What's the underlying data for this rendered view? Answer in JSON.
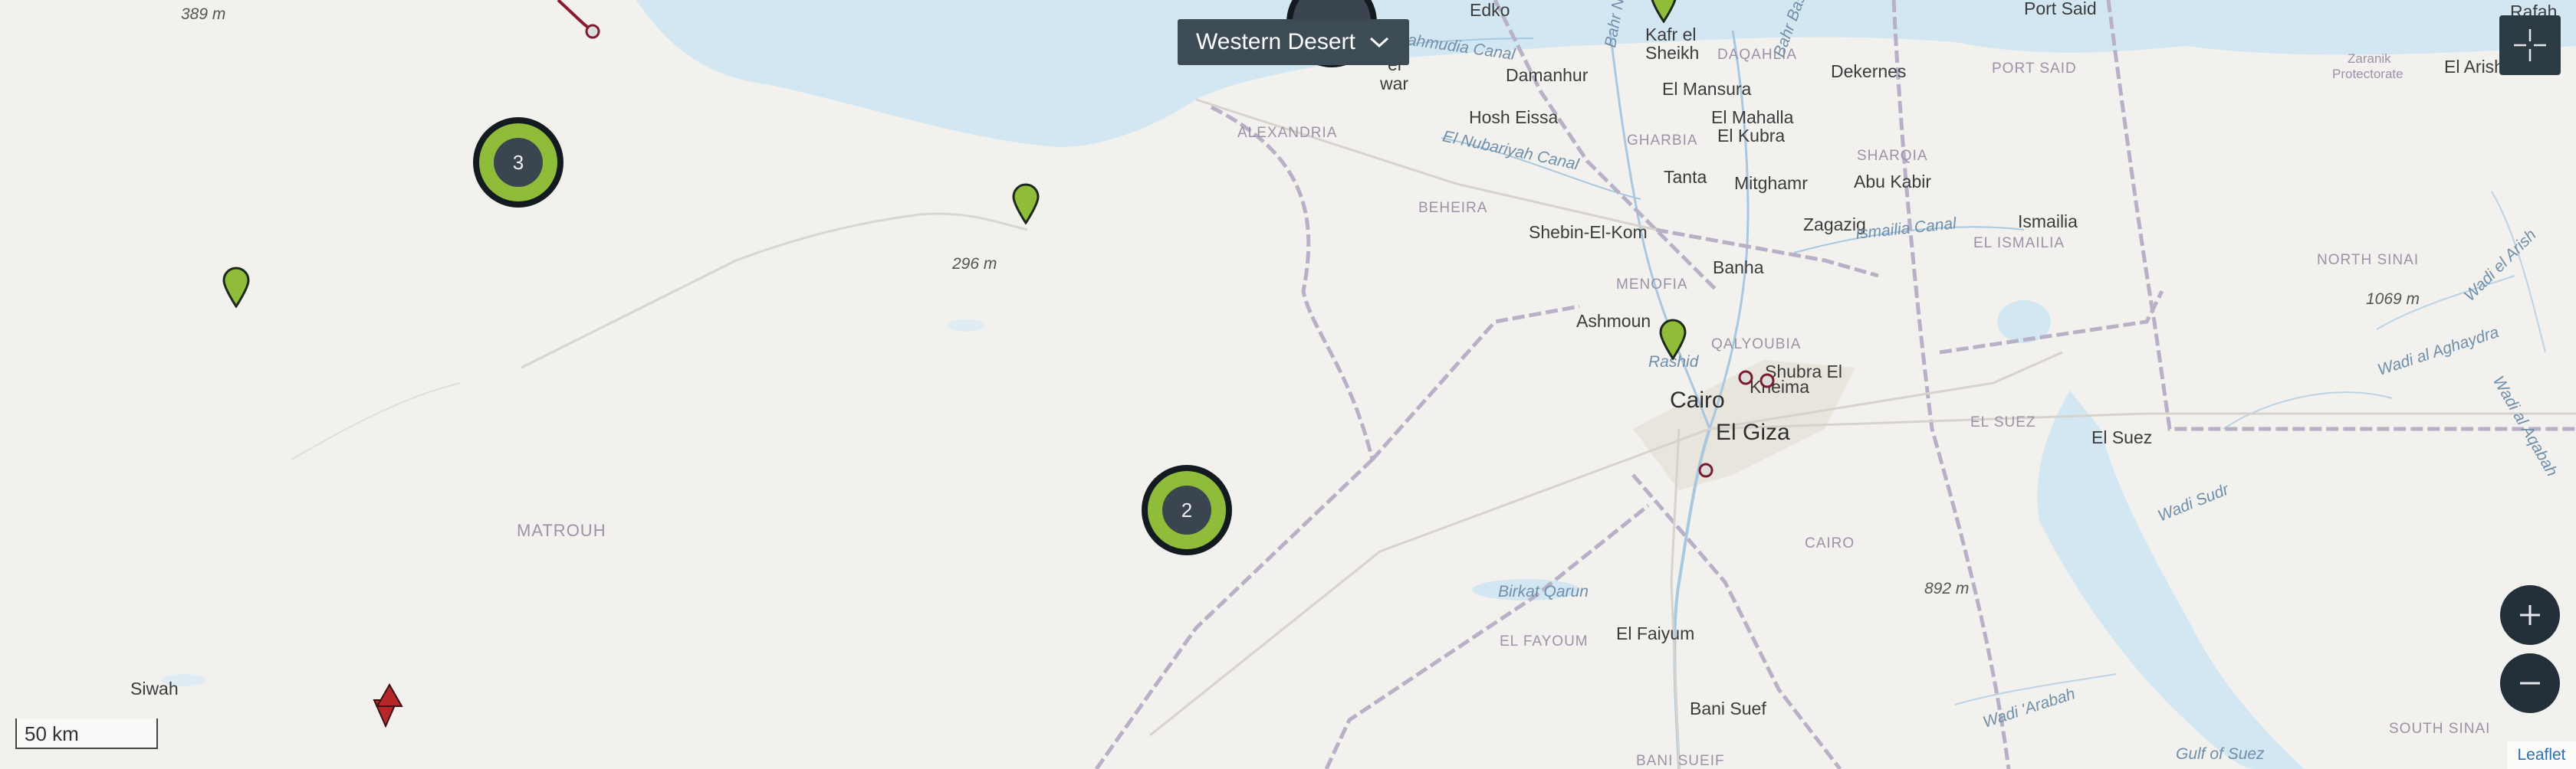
{
  "region_selector": {
    "label": "Western Desert"
  },
  "scale_bar": {
    "label": "50 km"
  },
  "attribution": {
    "label": "Leaflet"
  },
  "colors": {
    "cluster_ring": "#8fbd3a",
    "pin_green": "#8fbd3a",
    "pin_red": "#b4282a",
    "control_bg": "#23303a",
    "water": "#d3e7f3"
  },
  "clusters": [
    {
      "count": "3"
    },
    {
      "count": "2"
    }
  ],
  "labels": {
    "edko": "Edko",
    "kafr_el_sheikh_1": "Kafr el",
    "kafr_el_sheikh_2": "Sheikh",
    "port_said_city": "Port Said",
    "rafah": "Rafah",
    "damanhur": "Damanhur",
    "el_mansura": "El Mansura",
    "dekernes": "Dekernes",
    "el_arish": "El Arish",
    "hosh_eissa": "Hosh Eissa",
    "el_mahalla_1": "El Mahalla",
    "el_mahalla_2": "El Kubra",
    "tanta": "Tanta",
    "mitghamr": "Mitghamr",
    "abu_kabir": "Abu Kabir",
    "zagazig": "Zagazig",
    "ismailia": "Ismailia",
    "shebin": "Shebin-El-Kom",
    "banha": "Banha",
    "ashmoun": "Ashmoun",
    "shubra": "Shubra El",
    "kheima": "Kheima",
    "cairo": "Cairo",
    "el_giza": "El Giza",
    "el_suez": "El Suez",
    "el_faiyum": "El Faiyum",
    "bani_suef": "Bani Suef",
    "siwah": "Siwah",
    "el_wal_1": "el",
    "el_wal_2": "war",
    "region_alexandria": "ALEXANDRIA",
    "region_beheira": "BEHEIRA",
    "region_gharbia": "GHARBIA",
    "region_daqahlia": "DAQAHLIA",
    "region_port_said": "PORT SAID",
    "region_sharqia": "SHARQIA",
    "region_ismailia": "EL ISMAILIA",
    "region_menofia": "MENOFIA",
    "region_qalyoubia": "QALYOUBIA",
    "region_cairo": "CAIRO",
    "region_el_suez": "EL SUEZ",
    "region_fayoum": "EL FAYOUM",
    "region_beni_suef": "BANI SUEIF",
    "region_matrouh": "MATROUH",
    "region_north_sinai": "NORTH SINAI",
    "region_south_sinai": "SOUTH SINAI",
    "region_zaranik_1": "Zaranik",
    "region_zaranik_2": "Protectorate",
    "water_nubariyah": "El Nubariyah Canal",
    "water_mahmudia": "Mahmudia Canal",
    "water_ismailia": "Ismailia Canal",
    "water_birkat_qarun": "Birkat Qarun",
    "water_wadi_sudr": "Wadi Sudr",
    "water_wadi_arabah": "Wadi 'Arabah",
    "water_gulf_suez": "Gulf of Suez",
    "water_wadi_aghaydra": "Wadi al Aghaydra",
    "water_wadi_el_arish": "Wadi el Arish",
    "water_wadi_al_aqabah": "Wadi al Aqabah",
    "water_rashid": "Rashid",
    "water_bar_nashar": "Bahr Nashar",
    "water_bahr_basandi": "Bahr Basandi",
    "elev_389": "389 m",
    "elev_296": "296 m",
    "elev_1069": "1069 m",
    "elev_892": "892 m"
  }
}
